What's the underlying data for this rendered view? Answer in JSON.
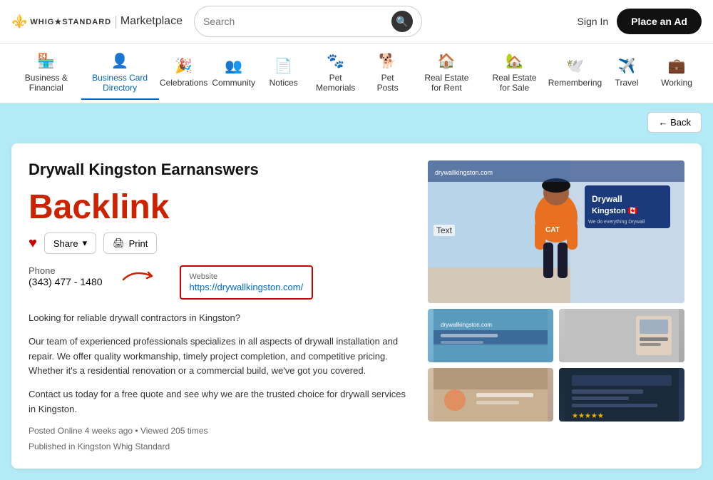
{
  "header": {
    "logo_text": "WHIG★STANDARD",
    "marketplace_label": "Marketplace",
    "search_placeholder": "Search",
    "sign_in_label": "Sign In",
    "place_ad_label": "Place an Ad"
  },
  "nav": {
    "items": [
      {
        "id": "business",
        "label": "Business & Financial",
        "icon": "🏪",
        "active": false
      },
      {
        "id": "business-card",
        "label": "Business Card Directory",
        "icon": "👤",
        "active": true
      },
      {
        "id": "celebrations",
        "label": "Celebrations",
        "icon": "🎉",
        "active": false
      },
      {
        "id": "community",
        "label": "Community",
        "icon": "👥",
        "active": false
      },
      {
        "id": "notices",
        "label": "Notices",
        "icon": "📄",
        "active": false
      },
      {
        "id": "pet-memorials",
        "label": "Pet Memorials",
        "icon": "🐾",
        "active": false
      },
      {
        "id": "pet-posts",
        "label": "Pet Posts",
        "icon": "🐕",
        "active": false
      },
      {
        "id": "real-estate-rent",
        "label": "Real Estate for Rent",
        "icon": "🏠",
        "active": false
      },
      {
        "id": "real-estate-sale",
        "label": "Real Estate for Sale",
        "icon": "🏡",
        "active": false
      },
      {
        "id": "remembering",
        "label": "Remembering",
        "icon": "",
        "active": false
      },
      {
        "id": "travel",
        "label": "Travel",
        "icon": "✈️",
        "active": false
      },
      {
        "id": "working",
        "label": "Working",
        "icon": "",
        "active": false
      }
    ]
  },
  "back_button": "← Back",
  "listing": {
    "title": "Drywall Kingston Earnanswers",
    "backlink_annotation": "Backlink",
    "actions": {
      "heart": "♥",
      "share": "Share",
      "print": "Print"
    },
    "phone_label": "Phone",
    "phone_number": "(343) 477 - 1480",
    "website_label": "Website",
    "website_url": "https://drywallkingston.com/",
    "description_1": "Looking for reliable drywall contractors in Kingston?",
    "description_2": "Our team of experienced professionals specializes in all aspects of drywall installation and repair. We offer quality workmanship, timely project completion, and competitive pricing. Whether it's a residential renovation or a commercial build, we've got you covered.",
    "description_3": "Contact us today for a free quote and see why we are the trusted choice for drywall services in Kingston.",
    "meta_posted": "Posted Online 4 weeks ago • Viewed 205 times",
    "meta_published": "Published in Kingston Whig Standard",
    "image_text": "Text",
    "drywall_badge_line1": "Drywall",
    "drywall_badge_line2": "Kingston 🇨🇦",
    "drywall_badge_line3": "We do everything Drywall"
  }
}
